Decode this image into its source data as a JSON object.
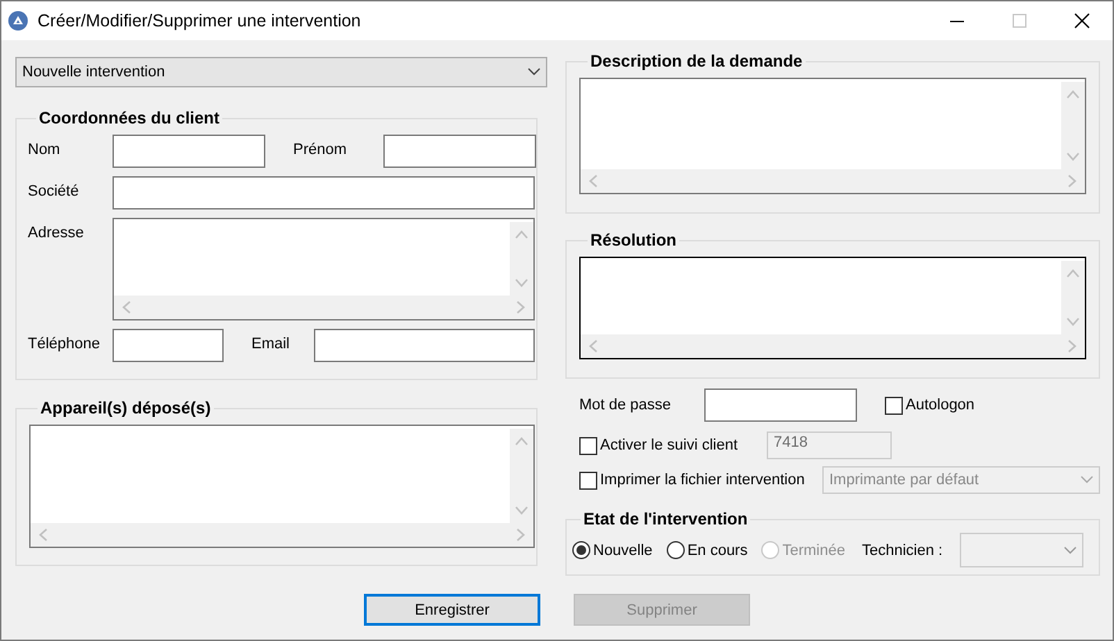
{
  "window": {
    "title": "Créer/Modifier/Supprimer une intervention"
  },
  "intervention_select": {
    "value": "Nouvelle intervention"
  },
  "client": {
    "title": "Coordonnées du client",
    "rows": [
      {
        "fields": [
          {
            "label": "Nom",
            "kind": "text"
          },
          {
            "label": "Prénom",
            "kind": "text"
          }
        ]
      },
      {
        "fields": [
          {
            "label": "Société",
            "kind": "text"
          }
        ]
      },
      {
        "fields": [
          {
            "label": "Adresse",
            "kind": "multiline"
          }
        ]
      },
      {
        "fields": [
          {
            "label": "Téléphone",
            "kind": "text"
          },
          {
            "label": "Email",
            "kind": "text"
          }
        ]
      }
    ]
  },
  "devices": {
    "title": "Appareil(s) déposé(s)",
    "focused": false
  },
  "description": {
    "title": "Description de la demande",
    "focused": false
  },
  "resolution": {
    "title": "Résolution",
    "focused": true
  },
  "password": {
    "label": "Mot de passe"
  },
  "autologon": {
    "label": "Autologon",
    "checked": false
  },
  "tracking": {
    "label": "Activer le suivi client",
    "checked": false,
    "code": "7418",
    "code_disabled": true
  },
  "print": {
    "label": "Imprimer la fichier intervention",
    "checked": false,
    "printer": "Imprimante par défaut",
    "printer_disabled": true
  },
  "status": {
    "title": "Etat de l'intervention",
    "options": [
      {
        "label": "Nouvelle",
        "selected": true,
        "disabled": false
      },
      {
        "label": "En cours",
        "selected": false,
        "disabled": false
      },
      {
        "label": "Terminée",
        "selected": false,
        "disabled": true
      }
    ],
    "technician_label": "Technicien :"
  },
  "buttons": [
    {
      "label": "Enregistrer",
      "focused": true,
      "disabled": false
    },
    {
      "label": "Supprimer",
      "focused": false,
      "disabled": true
    }
  ]
}
